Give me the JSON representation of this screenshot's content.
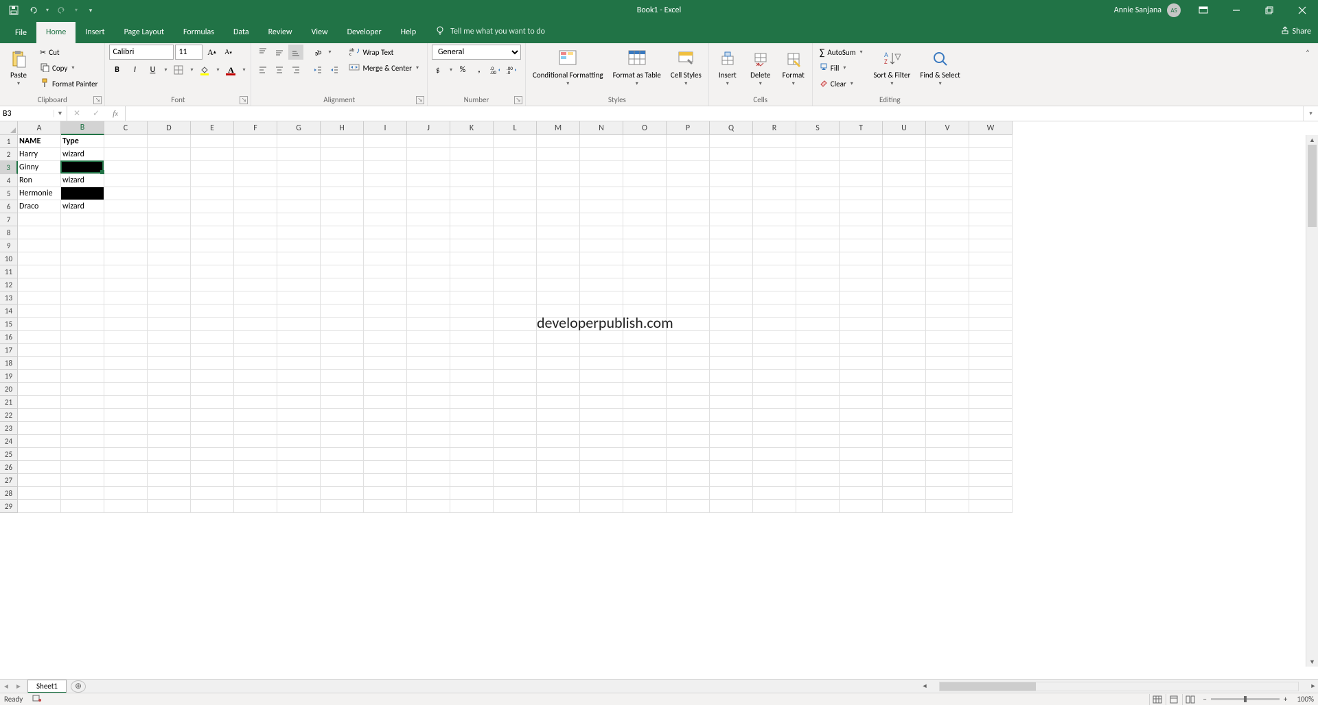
{
  "title": "Book1  -  Excel",
  "user": {
    "name": "Annie Sanjana",
    "initials": "AS"
  },
  "tabs": {
    "file": "File",
    "home": "Home",
    "insert": "Insert",
    "pagelayout": "Page Layout",
    "formulas": "Formulas",
    "data": "Data",
    "review": "Review",
    "view": "View",
    "developer": "Developer",
    "help": "Help"
  },
  "tellme": "Tell me what you want to do",
  "share": "Share",
  "clipboard": {
    "paste": "Paste",
    "cut": "Cut",
    "copy": "Copy",
    "fpainter": "Format Painter",
    "group": "Clipboard"
  },
  "font": {
    "name": "Calibri",
    "size": "11",
    "group": "Font"
  },
  "alignment": {
    "wrap": "Wrap Text",
    "merge": "Merge & Center",
    "group": "Alignment"
  },
  "number": {
    "format": "General",
    "group": "Number"
  },
  "styles": {
    "cond": "Conditional Formatting",
    "fat": "Format as Table",
    "cellst": "Cell Styles",
    "group": "Styles"
  },
  "cellsgrp": {
    "insert": "Insert",
    "delete": "Delete",
    "format": "Format",
    "group": "Cells"
  },
  "editing": {
    "autosum": "AutoSum",
    "fill": "Fill",
    "clear": "Clear",
    "sort": "Sort & Filter",
    "find": "Find & Select",
    "group": "Editing"
  },
  "namebox": "B3",
  "columns": [
    "A",
    "B",
    "C",
    "D",
    "E",
    "F",
    "G",
    "H",
    "I",
    "J",
    "K",
    "L",
    "M",
    "N",
    "O",
    "P",
    "Q",
    "R",
    "S",
    "T",
    "U",
    "V",
    "W"
  ],
  "rows_count": 29,
  "selected": {
    "col": 1,
    "row": 2
  },
  "data_rows": [
    {
      "a": "NAME",
      "b": "Type",
      "bold": true
    },
    {
      "a": "Harry",
      "b": "wizard"
    },
    {
      "a": "Ginny",
      "b": "",
      "blk": true
    },
    {
      "a": "Ron",
      "b": "wizard"
    },
    {
      "a": "Hermonie",
      "b": "",
      "blk": true
    },
    {
      "a": "Draco",
      "b": "wizard"
    }
  ],
  "watermark": "developerpublish.com",
  "sheet": "Sheet1",
  "status": "Ready",
  "zoom": "100%"
}
